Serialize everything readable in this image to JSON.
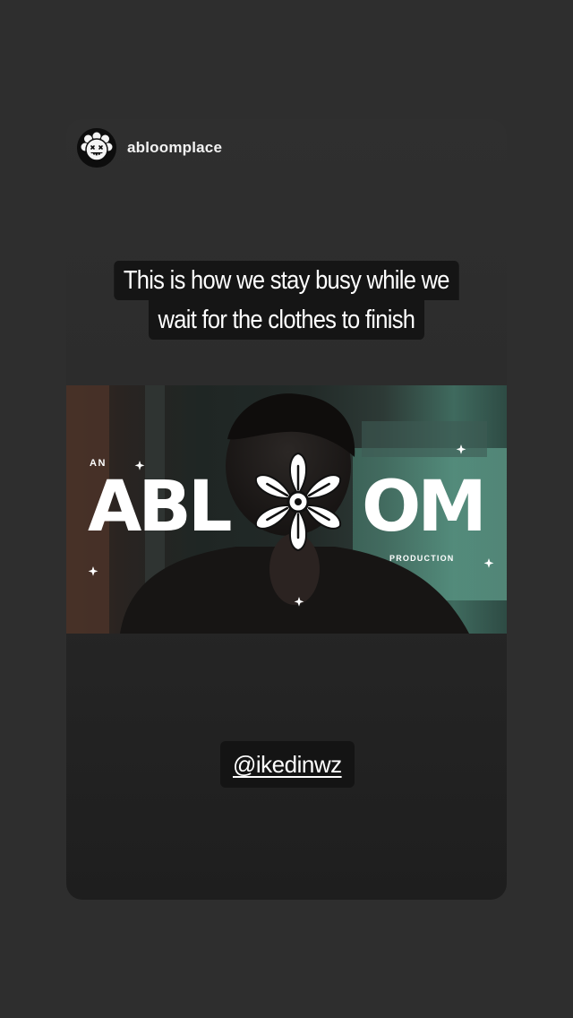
{
  "story": {
    "username": "abloomplace",
    "caption": {
      "line1": "This is how we stay busy while we",
      "line2": "wait for the clothes to finish"
    },
    "video_overlay": {
      "top_left": "AN",
      "brand": "ABLOOM",
      "brand_left": "ABL",
      "brand_right": "OM",
      "bottom_right": "PRODUCTION"
    },
    "mention": "@ikedinwz"
  },
  "colors": {
    "background": "#2e2e2e",
    "card": "#2c2c2c",
    "sticker_bg": "#141414",
    "text": "#ffffff"
  },
  "icons": {
    "avatar": "flower-face-avatar-icon",
    "brand_flower": "flower-logo-icon",
    "sparkle": "sparkle-icon"
  }
}
